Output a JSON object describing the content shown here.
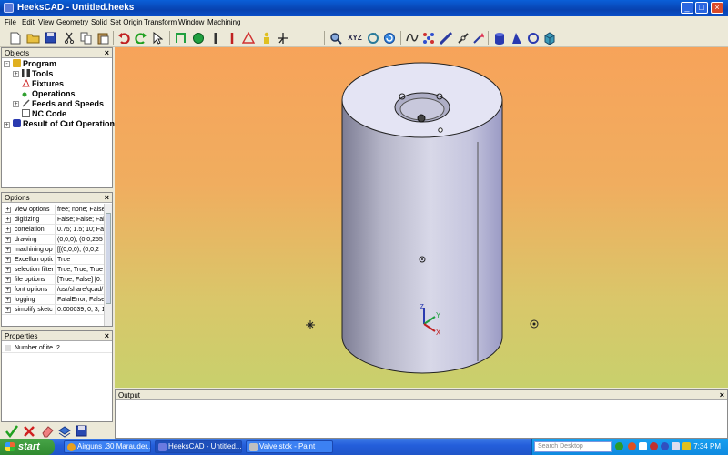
{
  "window": {
    "title": "HeeksCAD - Untitled.heeks",
    "min": "_",
    "max": "□",
    "close": "×"
  },
  "menu": [
    "File",
    "Edit",
    "View",
    "Geometry",
    "Solid",
    "Set Origin",
    "Transform",
    "Window",
    "Machining"
  ],
  "toolbar_icons": [
    "new-file-icon",
    "open-folder-icon",
    "save-icon",
    "cut-icon",
    "copy-icon",
    "paste-icon",
    "undo-icon",
    "redo-icon",
    "select-arrow-icon",
    "sketch-icon",
    "circle-icon",
    "spline-icon",
    "text-icon",
    "dimension-icon",
    "triangle-icon",
    "person-icon",
    "coordinate-icon",
    "magnify-icon",
    "view-xyz-icon",
    "view-back-icon",
    "rotate-icon",
    "spline-tool-icon",
    "pattern-icon",
    "line-tool-icon",
    "chain-icon",
    "star-icon",
    "cylinder-icon",
    "cone-icon",
    "sphere-icon",
    "cube-icon"
  ],
  "objects_panel": {
    "title": "Objects",
    "close": "×",
    "items": [
      {
        "label": "Program",
        "indent": 0,
        "expander": "-"
      },
      {
        "label": "Tools",
        "indent": 1,
        "expander": "+"
      },
      {
        "label": "Fixtures",
        "indent": 1,
        "expander": ""
      },
      {
        "label": "Operations",
        "indent": 1,
        "expander": ""
      },
      {
        "label": "Feeds and Speeds",
        "indent": 1,
        "expander": "+"
      },
      {
        "label": "NC Code",
        "indent": 1,
        "expander": ""
      },
      {
        "label": "Result of Cut Operation",
        "indent": 0,
        "expander": "+"
      }
    ]
  },
  "options_panel": {
    "title": "Options",
    "close": "×",
    "rows": [
      {
        "name": "view options",
        "value": "free; none; False"
      },
      {
        "name": "digitizing",
        "value": "False; False; Fals"
      },
      {
        "name": "correlation",
        "value": "0.75; 1.5; 10; Fa"
      },
      {
        "name": "drawing",
        "value": "(0,0,0); (0,0,255"
      },
      {
        "name": "machining opt",
        "value": "[[(0,0,0); (0,0,2"
      },
      {
        "name": "Excellon optio",
        "value": "True"
      },
      {
        "name": "selection filter",
        "value": "True; True; True"
      },
      {
        "name": "file options",
        "value": "[True; False] [0."
      },
      {
        "name": "font options",
        "value": "/usr/share/qcad/"
      },
      {
        "name": "logging",
        "value": "FatalError; False"
      },
      {
        "name": "simplify sketch",
        "value": "0.000039; 0; 3; 1"
      }
    ]
  },
  "properties_panel": {
    "title": "Properties",
    "close": "×",
    "row": {
      "name": "Number of ite",
      "value": "2"
    }
  },
  "output_panel": {
    "title": "Output",
    "close": "×"
  },
  "viewport": {
    "axis_labels": {
      "z": "Z",
      "y": "Y",
      "x": "X"
    }
  },
  "bottom_tools": [
    "check-icon",
    "cross-icon",
    "eraser-icon",
    "layers-icon",
    "save-small-icon"
  ],
  "taskbar": {
    "start": "start",
    "tasks": [
      {
        "label": "Airguns .30 Marauder...",
        "active": false,
        "color": "#e8a020"
      },
      {
        "label": "HeeksCAD - Untitled....",
        "active": true,
        "color": "#6a7ae0"
      },
      {
        "label": "Valve stck - Paint",
        "active": false,
        "color": "#c0c0c0"
      }
    ],
    "search_placeholder": "Search Desktop",
    "clock": "7:34 PM"
  }
}
